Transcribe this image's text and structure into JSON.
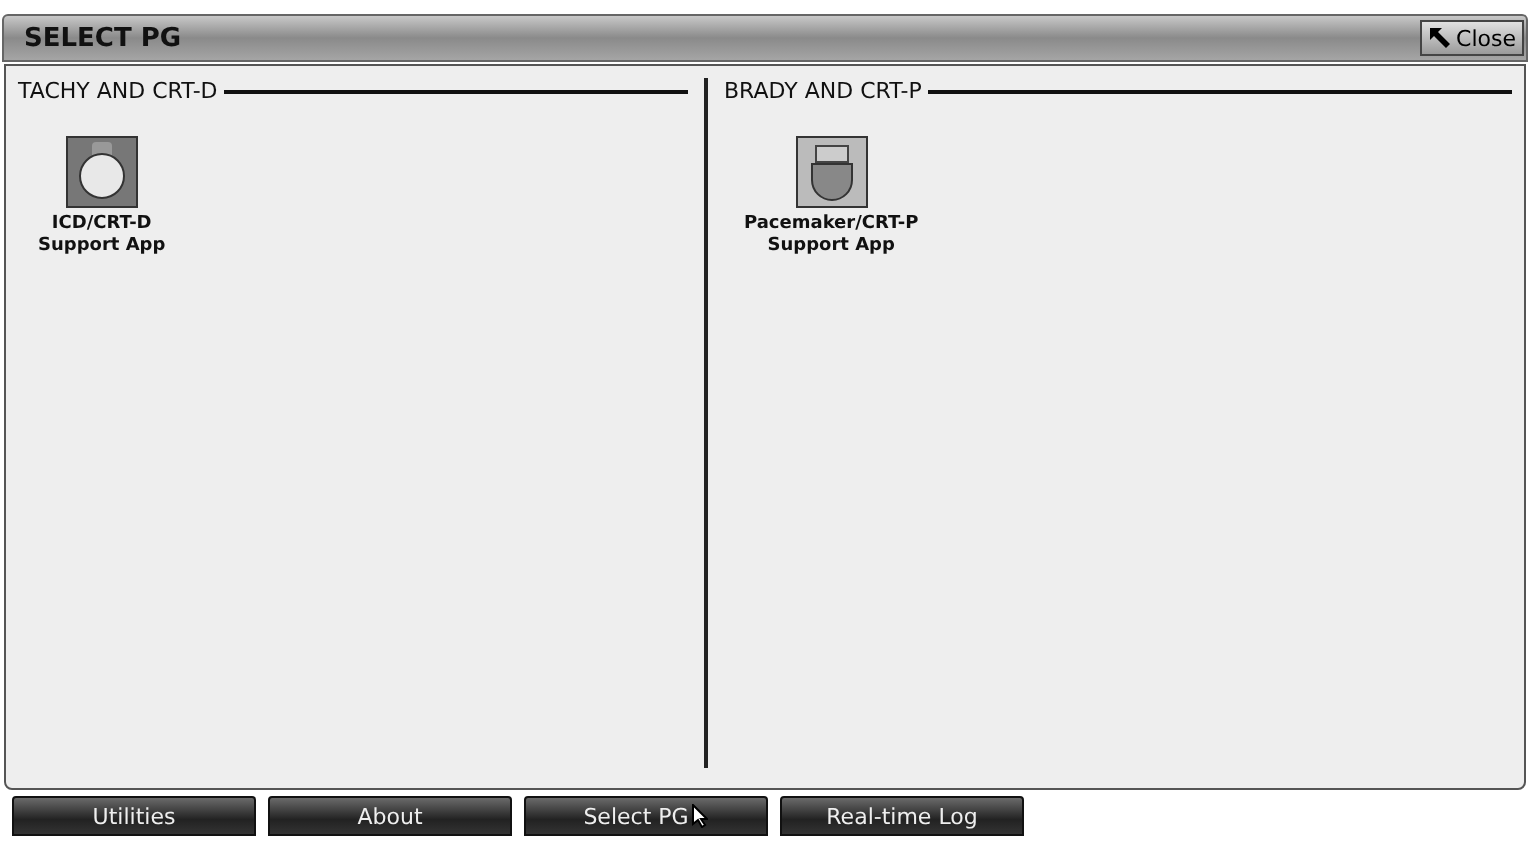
{
  "window": {
    "title": "SELECT PG",
    "close_button": "Close"
  },
  "groups": [
    {
      "title": "TACHY AND CRT-D",
      "apps": [
        {
          "kind": "icd",
          "label_line_1": "ICD/CRT-D",
          "label_line_2": "Support App"
        }
      ]
    },
    {
      "title": "BRADY AND CRT-P",
      "apps": [
        {
          "kind": "pacemaker",
          "label_line_1": "Pacemaker/CRT-P",
          "label_line_2": "Support App"
        }
      ]
    }
  ],
  "nav_buttons": [
    {
      "label": "Utilities",
      "pointer": false
    },
    {
      "label": "About",
      "pointer": false
    },
    {
      "label": "Select PG",
      "pointer": true
    },
    {
      "label": "Real-time Log",
      "pointer": false
    }
  ]
}
